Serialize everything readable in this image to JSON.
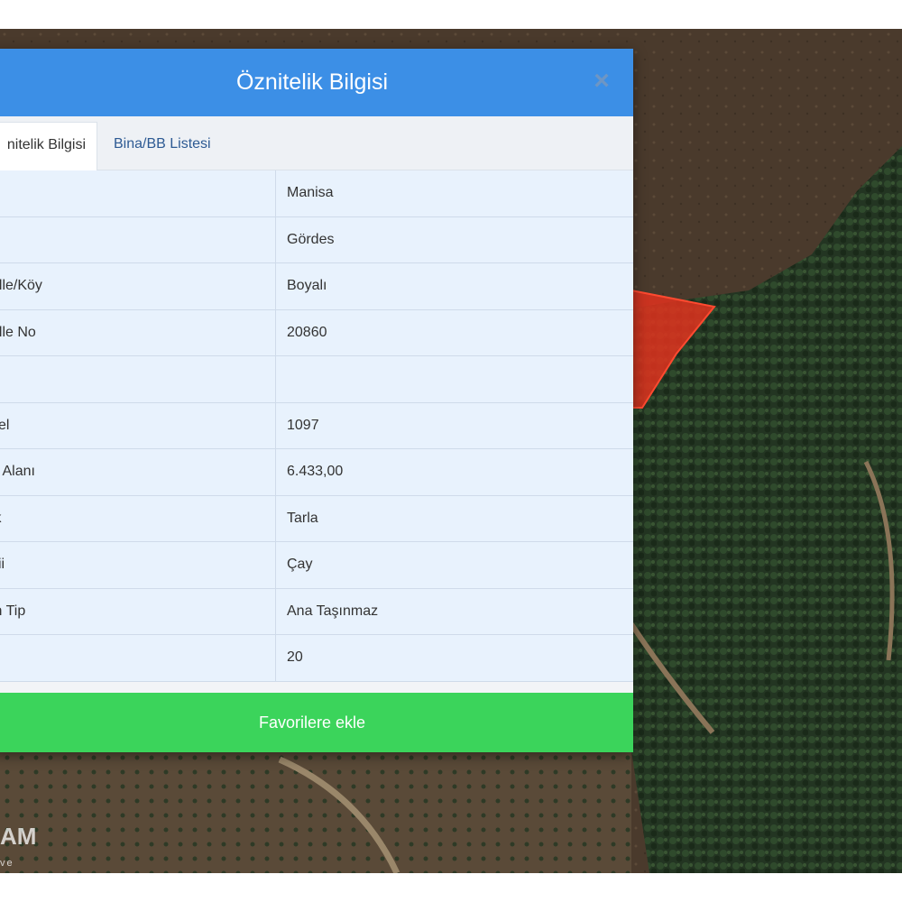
{
  "dialog": {
    "title": "Öznitelik Bilgisi",
    "close_symbol": "×",
    "tabs": [
      {
        "label": "Öznitelik Bilgisi",
        "visible_label": "nitelik Bilgisi",
        "active": true
      },
      {
        "label": "Bina/BB Listesi",
        "active": false
      }
    ],
    "rows": [
      {
        "label": "",
        "value": "Manisa"
      },
      {
        "label": "",
        "value": "Gördes"
      },
      {
        "label": "alle/Köy",
        "value": "Boyalı"
      },
      {
        "label": "alle No",
        "value": "20860"
      },
      {
        "label": "",
        "value": ""
      },
      {
        "label": "sel",
        "value": "1097"
      },
      {
        "label": "u Alanı",
        "value": "6.433,00"
      },
      {
        "label": "ik",
        "value": "Tarla"
      },
      {
        "label": "kii",
        "value": "Çay"
      },
      {
        "label": "in Tip",
        "value": "Ana Taşınmaz"
      },
      {
        "label": "a",
        "value": "20"
      }
    ],
    "favorite_button": "Favorilere ekle"
  },
  "watermark": {
    "text": "AM",
    "sub": "ve"
  },
  "colors": {
    "header": "#3c8fe6",
    "button": "#3bd45b",
    "parcel_highlight": "#e0321e"
  }
}
